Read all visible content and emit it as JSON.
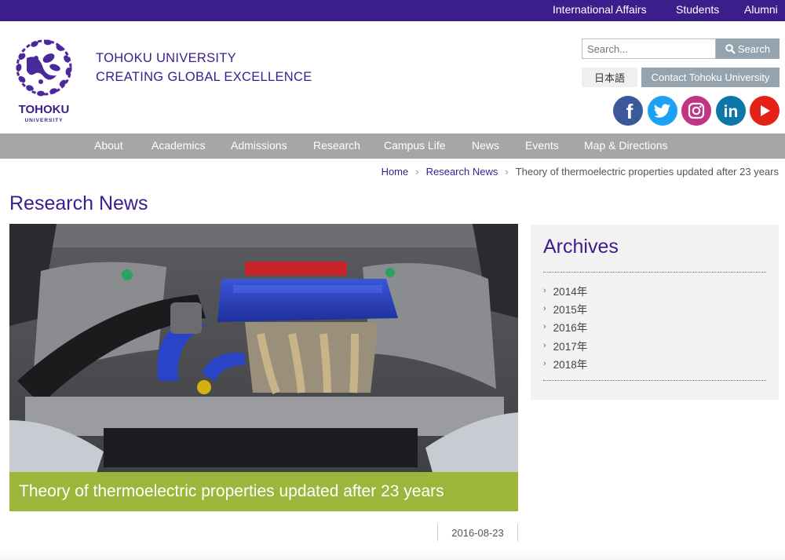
{
  "topbar": {
    "links": [
      "International Affairs",
      "Students",
      "Alumni"
    ]
  },
  "header": {
    "logo_text": "TOHOKU",
    "logo_subtext": "UNIVERSITY",
    "tagline_1": "TOHOKU UNIVERSITY",
    "tagline_2": "CREATING GLOBAL EXCELLENCE",
    "search_placeholder": "Search...",
    "search_button": "Search",
    "language_button": "日本語",
    "contact_button": "Contact Tohoku University",
    "social": [
      {
        "icon": "facebook-icon",
        "color": "#3b5998"
      },
      {
        "icon": "twitter-icon",
        "color": "#1da1f2"
      },
      {
        "icon": "instagram-icon",
        "color": "#c13584"
      },
      {
        "icon": "linkedin-icon",
        "color": "#0e76a8"
      },
      {
        "icon": "youtube-icon",
        "color": "#e62117"
      }
    ]
  },
  "nav": {
    "items": [
      "About",
      "Academics",
      "Admissions",
      "Research",
      "Campus Life",
      "News",
      "Events",
      "Map & Directions"
    ]
  },
  "breadcrumb": {
    "home": "Home",
    "section": "Research News",
    "current": "Theory of thermoelectric properties updated after 23 years"
  },
  "main": {
    "page_title": "Research News",
    "article_title": "Theory of thermoelectric properties updated after 23 years",
    "date": "2016-08-23"
  },
  "archives": {
    "title": "Archives",
    "years": [
      "2014年",
      "2015年",
      "2016年",
      "2017年",
      "2018年"
    ]
  },
  "colors": {
    "brand_purple": "#3b1d8c",
    "nav_gray": "#a6a6a6",
    "caption_green": "#9cb63c",
    "button_gray": "#94a3ad"
  }
}
